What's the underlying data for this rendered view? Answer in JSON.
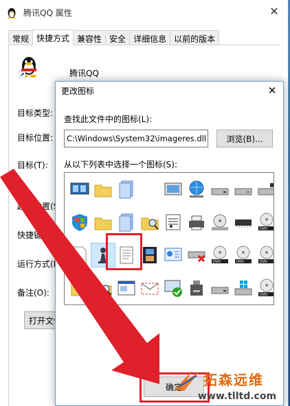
{
  "properties_window": {
    "title": "腾讯QQ 属性",
    "tabs": [
      "常规",
      "快捷方式",
      "兼容性",
      "安全",
      "详细信息",
      "以前的版本"
    ],
    "active_tab": 1,
    "app_name": "腾讯QQ",
    "labels": {
      "target_type": "目标类型:",
      "target_location": "目标位置:",
      "target": "目标(T):",
      "start_in": "起始位置(S",
      "shortcut_key": "快捷键(K",
      "run": "运行方式(R",
      "comment": "备注(O):"
    },
    "open_file_location_button": "打开文件"
  },
  "change_icon_dialog": {
    "title": "更改图标",
    "search_label": "查找此文件中的图标(L):",
    "path_value": "C:\\Windows\\System32\\imageres.dll",
    "browse_button": "浏览(B)...",
    "list_label": "从以下列表中选择一个图标(S):",
    "ok_button": "确定",
    "icons": [
      [
        "monitor-group-icon",
        "folder-icon",
        "document-stack-icon",
        "blank-icon",
        "picture-monitor-icon",
        "globe-network-icon",
        "drive-icon",
        "drive-green-icon",
        "drive-lock-icon"
      ],
      [
        "windows-shield-icon",
        "folder-icon",
        "document-stack-icon",
        "folder-search-icon",
        "music-sheet-icon",
        "printer-icon",
        "disc-drive-icon",
        "memory-chip-icon",
        "dvd-icon"
      ],
      [
        "blank-file-icon",
        "chess-pawn-icon",
        "text-document-icon",
        "film-icon",
        "control-panel-icon",
        "drive-error-icon",
        "dvd-icon",
        "dvd-icon",
        "dvd-icon"
      ],
      [
        "folder-icon",
        "folder-search-icon",
        "window-icon",
        "envelope-icon",
        "monitor-check-icon",
        "usb-drive-icon",
        "drive-icon",
        "windows-drive-icon",
        "dvd-icon"
      ]
    ],
    "selected_icon": "chess-pawn-icon"
  },
  "watermark": {
    "brand": "拓森远维",
    "url": "www.tlltd.com"
  },
  "colors": {
    "highlight_red": "#e0202a",
    "watermark_orange": "#e06a10"
  }
}
